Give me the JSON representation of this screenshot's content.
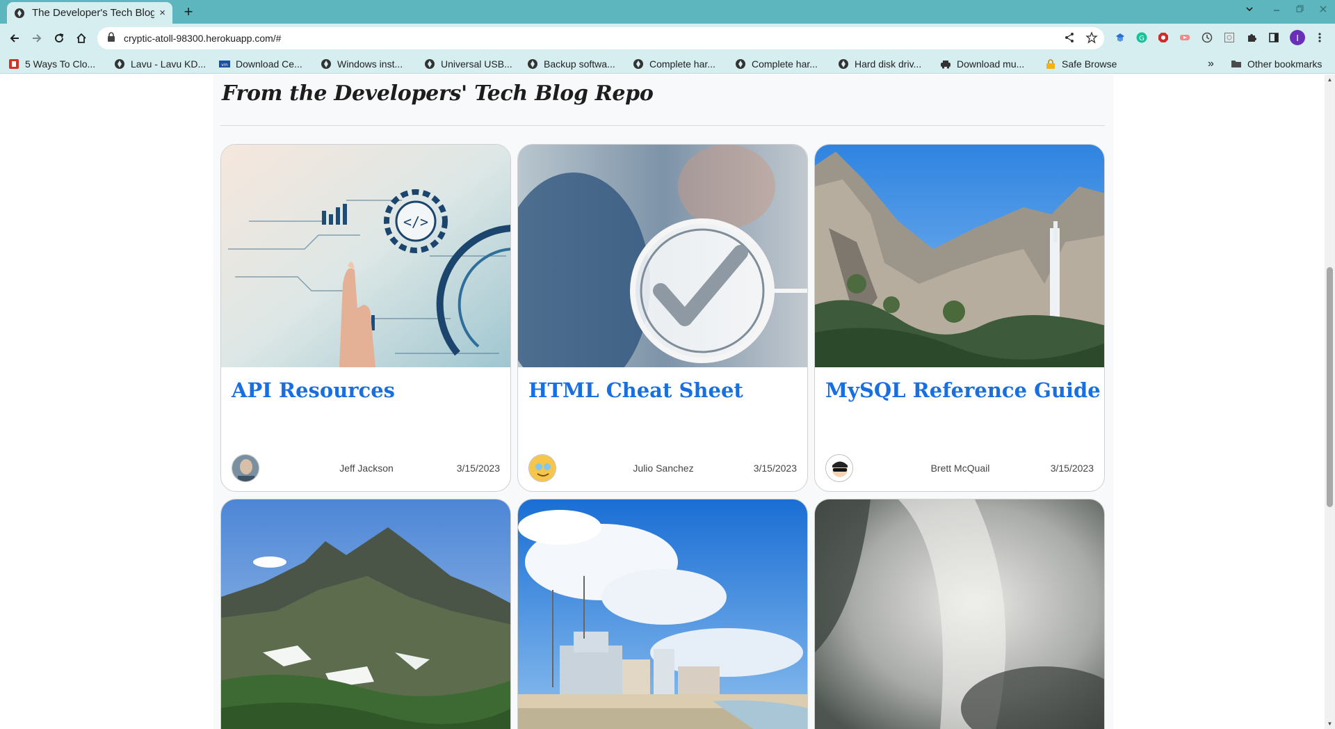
{
  "browser": {
    "tab_title": "The Developer's Tech Blog",
    "tab_close": "×",
    "new_tab": "+",
    "url": "cryptic-atoll-98300.herokuapp.com/#",
    "bookmarks": [
      {
        "label": "5 Ways To Clo...",
        "icon": "red-icon"
      },
      {
        "label": "Lavu - Lavu KD...",
        "icon": "globe-icon"
      },
      {
        "label": "Download Ce...",
        "icon": "vmware-icon"
      },
      {
        "label": "Windows inst...",
        "icon": "globe-icon"
      },
      {
        "label": "Universal USB...",
        "icon": "globe-icon"
      },
      {
        "label": "Backup softwa...",
        "icon": "globe-icon"
      },
      {
        "label": "Complete har...",
        "icon": "globe-icon"
      },
      {
        "label": "Complete har...",
        "icon": "globe-icon"
      },
      {
        "label": "Hard disk driv...",
        "icon": "globe-icon"
      },
      {
        "label": "Download mu...",
        "icon": "car-icon"
      },
      {
        "label": "Safe Browse",
        "icon": "lock-icon"
      }
    ],
    "overflow": "»",
    "other_bookmarks": "Other bookmarks",
    "profile_initial": "I"
  },
  "page": {
    "section_title": "From the Developers' Tech Blog Repo",
    "cards": [
      {
        "title": "API Resources",
        "author": "Jeff Jackson",
        "date": "3/15/2023",
        "image": "tech-interface-image"
      },
      {
        "title": "HTML Cheat Sheet",
        "author": "Julio Sanchez",
        "date": "3/15/2023",
        "image": "checkmark-image"
      },
      {
        "title": "MySQL Reference Guide",
        "author": "Brett McQuail",
        "date": "3/15/2023",
        "image": "waterfall-image"
      },
      {
        "title": "",
        "author": "",
        "date": "",
        "image": "mountain-image"
      },
      {
        "title": "",
        "author": "",
        "date": "",
        "image": "beach-hotel-image"
      },
      {
        "title": "",
        "author": "",
        "date": "",
        "image": "blurred-image"
      }
    ]
  },
  "colors": {
    "tabbar": "#5db6be",
    "toolbar": "#d6eef0",
    "link": "#1a6fe0"
  }
}
